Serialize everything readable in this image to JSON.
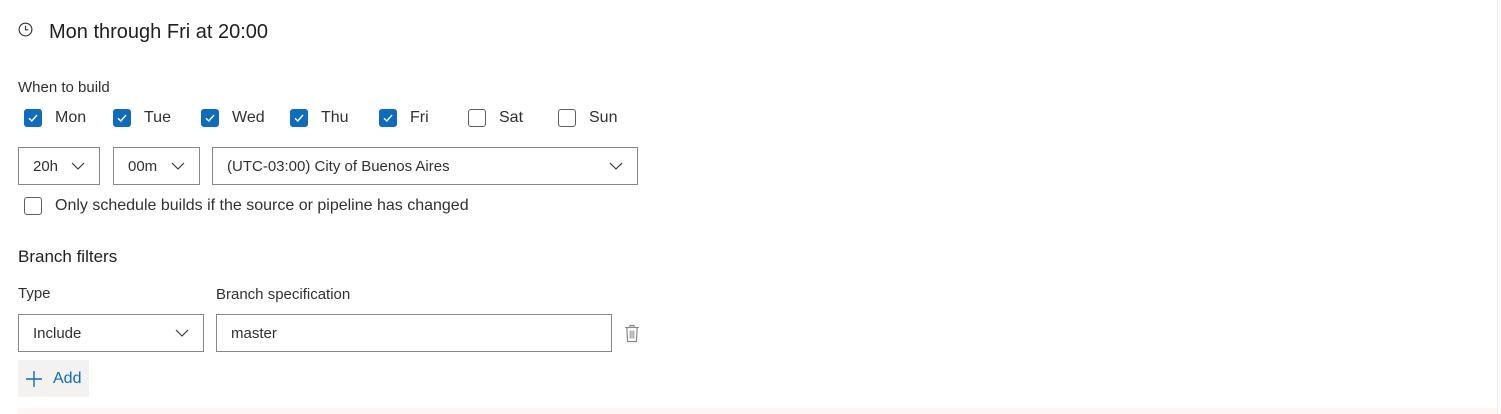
{
  "schedule": {
    "title": "Mon through Fri at 20:00",
    "when_to_build_label": "When to build",
    "days": [
      {
        "label": "Mon",
        "checked": true
      },
      {
        "label": "Tue",
        "checked": true
      },
      {
        "label": "Wed",
        "checked": true
      },
      {
        "label": "Thu",
        "checked": true
      },
      {
        "label": "Fri",
        "checked": true
      },
      {
        "label": "Sat",
        "checked": false
      },
      {
        "label": "Sun",
        "checked": false
      }
    ],
    "hour": "20h",
    "minute": "00m",
    "timezone": "(UTC-03:00) City of Buenos Aires",
    "only_if_changed_label": "Only schedule builds if the source or pipeline has changed",
    "only_if_changed_checked": false
  },
  "branch_filters": {
    "title": "Branch filters",
    "type_label": "Type",
    "spec_label": "Branch specification",
    "rows": [
      {
        "type": "Include",
        "spec": "master"
      }
    ],
    "add_label": "Add"
  },
  "colors": {
    "accent": "#0f6cbd",
    "border": "#8a8886",
    "text": "#323130"
  },
  "icons": {
    "clock": "clock-icon",
    "check": "checkmark-icon",
    "chevron": "chevron-down-icon",
    "trash": "trash-icon",
    "add": "plus-icon"
  }
}
